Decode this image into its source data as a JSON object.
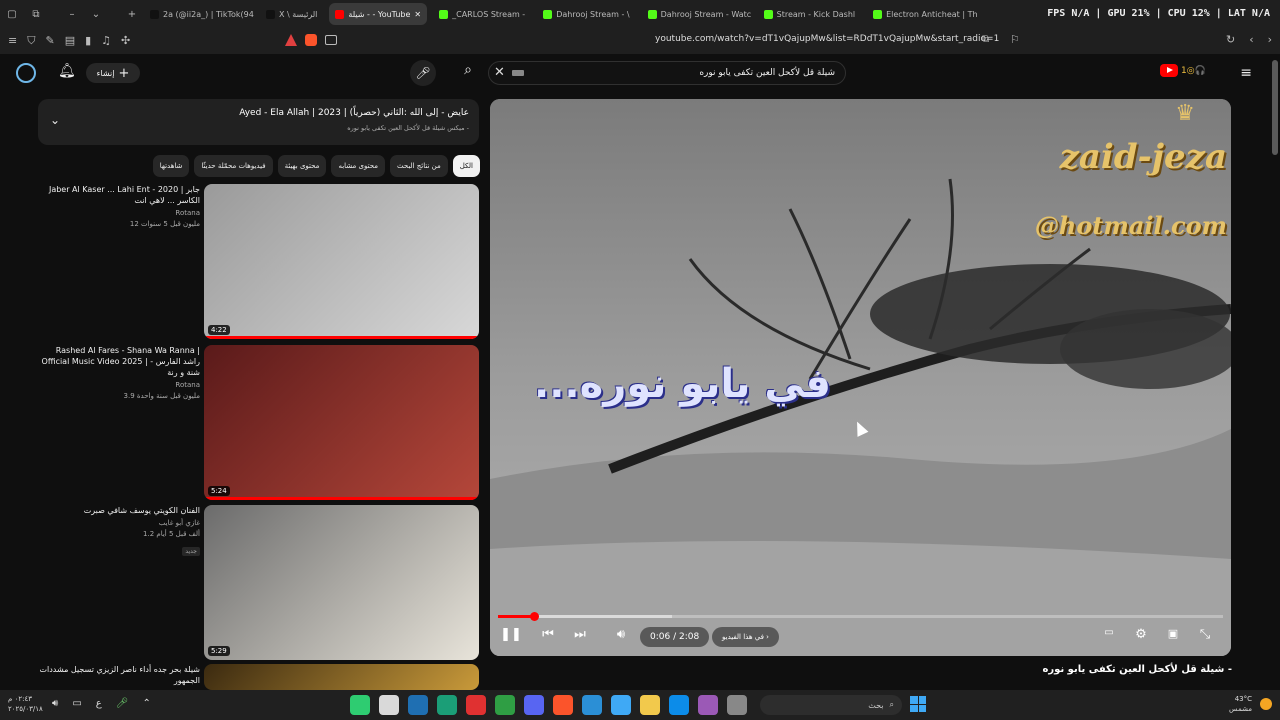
{
  "browser": {
    "tabs": [
      {
        "label": "2a (@ii2a_) | TikTok(94)",
        "color": "#111111"
      },
      {
        "label": "X \\ الرئيسة",
        "color": "#111111"
      },
      {
        "label": "شيلة - - YouTube",
        "color": "#ff0000",
        "active": true
      },
      {
        "label": "_CARLOS Stream -",
        "color": "#53fc18"
      },
      {
        "label": "Dahrooj Stream - \\",
        "color": "#53fc18"
      },
      {
        "label": "Dahrooj Stream - Watc",
        "color": "#53fc18"
      },
      {
        "label": "Stream - Kick Dashl",
        "color": "#53fc18"
      },
      {
        "label": "Electron Anticheat | Th",
        "color": "#53fc18"
      }
    ],
    "stats": "FPS N/A  |  GPU 21%  |  CPU 12%  |  LAT N/A",
    "url": "youtube.com/watch?v=dT1vQajupMw&list=RDdT1vQajupMw&start_radio=1"
  },
  "header": {
    "create_label": "إنشاء",
    "search_value": "شيلة قل لأكحل العين تكفى يابو نوره"
  },
  "playlist": {
    "title": "Ayed - Ela Allah | 2023 | (حصرياً) عايض - إلى الله :الثاني",
    "subtitle": "ميكس شيلة قل لأكحل العين تكفى يابو نوره -"
  },
  "chips": [
    {
      "label": "الكل",
      "active": true
    },
    {
      "label": "من نتائج البحث"
    },
    {
      "label": "محتوى مشابه"
    },
    {
      "label": "محتوى بهيئة"
    },
    {
      "label": "فيديوهات محمّلة حديثًا"
    },
    {
      "label": "شاهدتها"
    }
  ],
  "videos": [
    {
      "title": "Jaber Al Kaser ... Lahi Ent - 2020 | جابر الكاسر ... لاهي انت",
      "channel": "Rotana",
      "meta": "12 مليون  قبل 5 سنوات",
      "duration": "4:22",
      "progress": 1.0,
      "thumb_a": "#9a9a9a",
      "thumb_b": "#d8d8d8"
    },
    {
      "title": "Rashed Al Fares - Shana Wa Ranna | Official Music Video 2025 | راشد الفارس - شنة و رنة",
      "channel": "Rotana",
      "meta": "3.9 مليون  قبل سنة واحدة",
      "duration": "5:24",
      "progress": 1.0,
      "thumb_a": "#5a1a1a",
      "thumb_b": "#b5473a"
    },
    {
      "title": "الفنان الكويتي يوسف شافي صبرت",
      "channel": "غازي أبو غايب",
      "meta": "1.2 ألف  قبل 5 أيام",
      "duration": "5:29",
      "badge": "جديد",
      "thumb_a": "#6b6b6b",
      "thumb_b": "#e8e4da"
    },
    {
      "title": "شيلة بحر جده  أداء ناصر الزيزي  تسجيل مشددات الجمهور",
      "channel": "",
      "meta": "",
      "duration": "",
      "thumb_a": "#3b2a10",
      "thumb_b": "#c99a3a"
    }
  ],
  "player": {
    "watermark_1": "zaid-jeza",
    "watermark_2": "@hotmail.com",
    "subtitle_text": "...في يابو نوره",
    "time_current": "0:06",
    "time_total": "2:08",
    "chapter": "في هذا الفيديو",
    "progress": 0.05,
    "buffered": 0.24
  },
  "video_title": "شيلة قل لأكحل العين تكفى يابو نوره -",
  "taskbar": {
    "time": "٠٢:٤٣ م",
    "date": "٢٠٢٥/٠٣/١٨",
    "search_label": "بحث",
    "temp": "43°C",
    "weather": "مشمس"
  }
}
